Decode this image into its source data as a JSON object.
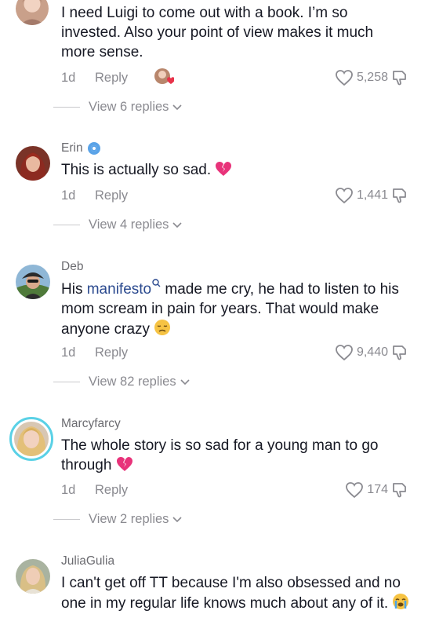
{
  "comments": [
    {
      "username": "",
      "text_parts": [
        "I need Luigi to come out with a book. I’m so invested. Also your point of view makes it much more sense."
      ],
      "time": "1d",
      "reply_label": "Reply",
      "likes": "5,258",
      "view_replies": "View 6 replies"
    },
    {
      "username": "Erin",
      "text_parts": [
        "This is actually so sad. "
      ],
      "emoji": "broken-heart",
      "time": "1d",
      "reply_label": "Reply",
      "likes": "1,441",
      "view_replies": "View 4 replies"
    },
    {
      "username": "Deb",
      "text_before": "His ",
      "link": "manifesto",
      "text_after": " made me cry, he had to listen to his mom scream in pain for years. That would make anyone crazy ",
      "emoji": "disappointed-face",
      "time": "1d",
      "reply_label": "Reply",
      "likes": "9,440",
      "view_replies": "View 82 replies"
    },
    {
      "username": "Marcyfarcy",
      "text_parts": [
        "The whole story is so sad for a young man to go through "
      ],
      "emoji": "broken-heart",
      "time": "1d",
      "reply_label": "Reply",
      "likes": "174",
      "view_replies": "View 2 replies"
    },
    {
      "username": "JuliaGulia",
      "text_parts": [
        "I can't get off TT because I'm also obsessed and no one in my regular life knows much about any of it. "
      ],
      "emoji": "crying-face"
    }
  ],
  "icons": {
    "like": "heart-outline-icon",
    "dislike": "thumbs-down-icon",
    "chevron": "chevron-down-icon",
    "search": "search-icon"
  },
  "colors": {
    "text": "#161823",
    "secondary": "#8a8a90",
    "link": "#2b4a8f",
    "story_ring": "#5ad1e6",
    "verified": "#5aa3e8"
  }
}
